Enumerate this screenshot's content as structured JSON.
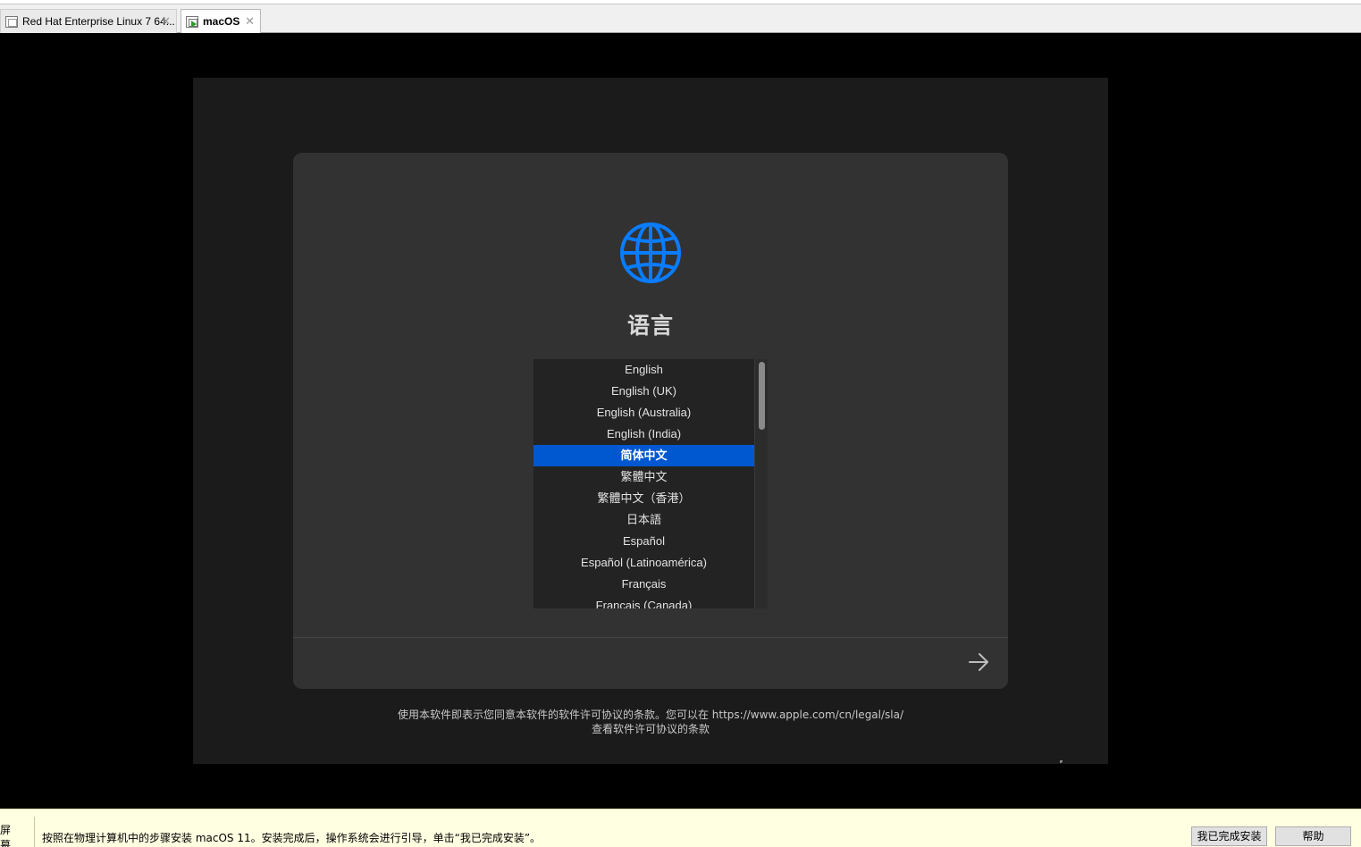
{
  "tabs": [
    {
      "label": "Red Hat Enterprise Linux 7 64...",
      "close": "✕",
      "active": false
    },
    {
      "label": "macOS",
      "close": "✕",
      "active": true
    }
  ],
  "installer": {
    "title": "语言",
    "languages": [
      "English",
      "English (UK)",
      "English (Australia)",
      "English (India)",
      "简体中文",
      "繁體中文",
      "繁體中文（香港）",
      "日本語",
      "Español",
      "Español (Latinoamérica)",
      "Français",
      "Français (Canada)"
    ],
    "selected_index": 4,
    "license_line1": "使用本软件即表示您同意本软件的软件许可协议的条款。您可以在 https://www.apple.com/cn/legal/sla/",
    "license_line2": "查看软件许可协议的条款",
    "accent_color": "#0a7cff"
  },
  "hintbar": {
    "left_fragment": "屏幕",
    "message": "按照在物理计算机中的步骤安装 macOS 11。安装完成后，操作系统会进行引导，单击“我已完成安装”。",
    "done_button": "我已完成安装",
    "help_button": "帮助"
  }
}
